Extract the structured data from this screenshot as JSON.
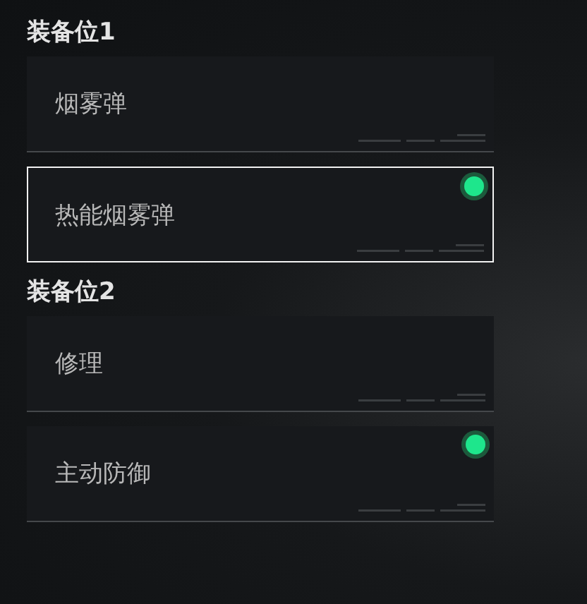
{
  "slots": [
    {
      "title": "装备位1",
      "options": [
        {
          "label": "烟雾弹",
          "selected": false,
          "equipped": false
        },
        {
          "label": "热能烟雾弹",
          "selected": true,
          "equipped": true
        }
      ]
    },
    {
      "title": "装备位2",
      "options": [
        {
          "label": "修理",
          "selected": false,
          "equipped": false
        },
        {
          "label": "主动防御",
          "selected": false,
          "equipped": true
        }
      ]
    }
  ]
}
